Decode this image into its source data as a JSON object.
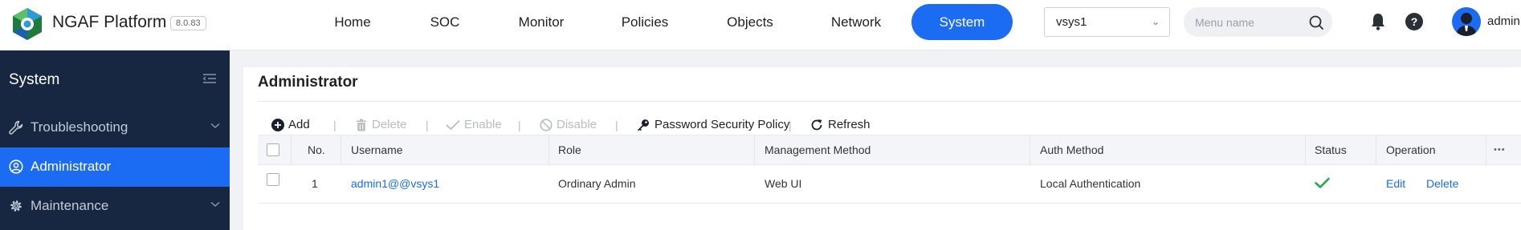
{
  "header": {
    "brand": "NGAF Platform",
    "version": "8.0.83",
    "nav": [
      {
        "label": "Home"
      },
      {
        "label": "SOC"
      },
      {
        "label": "Monitor"
      },
      {
        "label": "Policies"
      },
      {
        "label": "Objects"
      },
      {
        "label": "Network"
      },
      {
        "label": "System",
        "active": true
      }
    ],
    "vsys_selected": "vsys1",
    "search_placeholder": "Menu name",
    "user": "admin",
    "help_glyph": "?"
  },
  "sidebar": {
    "title": "System",
    "items": [
      {
        "label": "Troubleshooting",
        "icon": "wrench-icon",
        "expandable": true
      },
      {
        "label": "Administrator",
        "icon": "user-circle-icon",
        "active": true
      },
      {
        "label": "Maintenance",
        "icon": "gear-icon",
        "expandable": true
      }
    ]
  },
  "main": {
    "title": "Administrator",
    "toolbar": {
      "add": "Add",
      "delete": "Delete",
      "enable": "Enable",
      "disable": "Disable",
      "password_policy": "Password Security Policy",
      "refresh": "Refresh",
      "separator": "|"
    },
    "table": {
      "columns": [
        "No.",
        "Username",
        "Role",
        "Management Method",
        "Auth Method",
        "Status",
        "Operation"
      ],
      "more_glyph": "•••",
      "rows": [
        {
          "no": "1",
          "username": "admin1@@vsys1",
          "role": "Ordinary Admin",
          "management_method": "Web UI",
          "auth_method": "Local Authentication",
          "status": "enabled",
          "edit": "Edit",
          "delete": "Delete"
        }
      ]
    }
  },
  "colors": {
    "accent": "#1b6cf2",
    "sidebar_bg": "#172641",
    "status_ok": "#2ca84a"
  }
}
